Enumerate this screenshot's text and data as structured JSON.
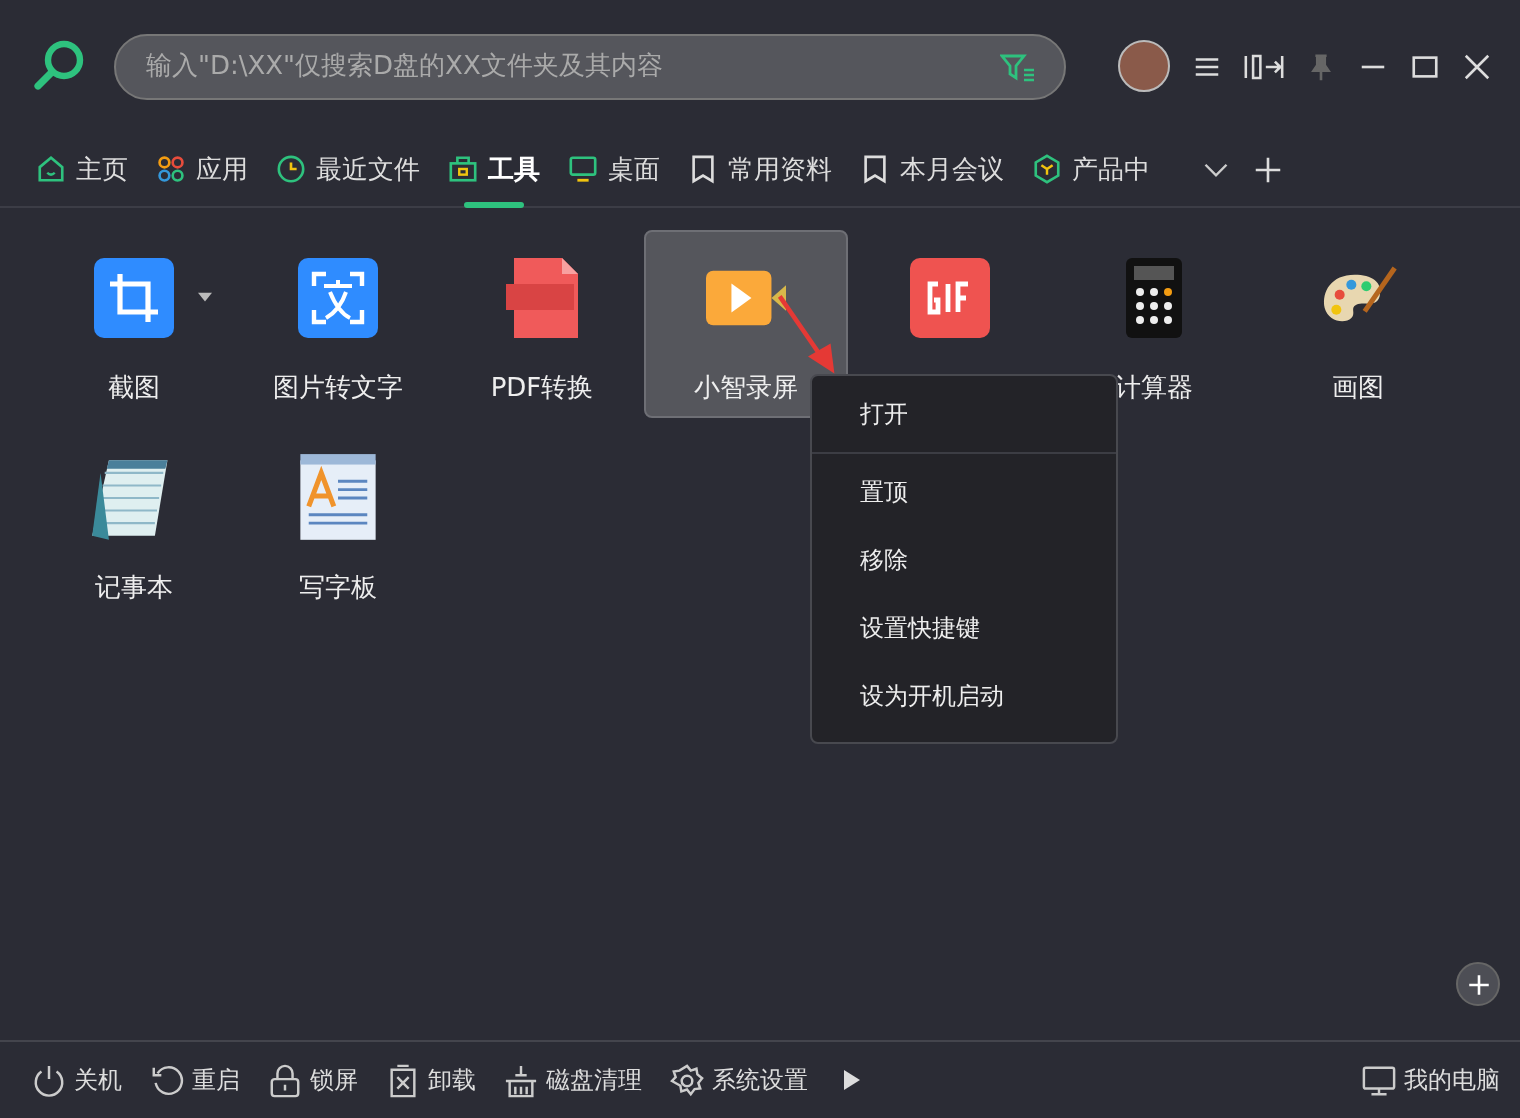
{
  "search": {
    "placeholder": "输入\"D:\\XX\"仅搜索D盘的XX文件夹及其内容"
  },
  "tabs": [
    {
      "label": "主页",
      "kind": "home",
      "selected": false
    },
    {
      "label": "应用",
      "kind": "apps",
      "selected": false
    },
    {
      "label": "最近文件",
      "kind": "clock",
      "selected": false
    },
    {
      "label": "工具",
      "kind": "toolbox",
      "selected": true
    },
    {
      "label": "桌面",
      "kind": "monitor",
      "selected": false
    },
    {
      "label": "常用资料",
      "kind": "bookmark",
      "selected": false
    },
    {
      "label": "本月会议",
      "kind": "bookmark",
      "selected": false
    },
    {
      "label": "产品中",
      "kind": "cube",
      "selected": false
    }
  ],
  "tools": [
    {
      "name": "截图",
      "kind": "crop",
      "selected": false,
      "dropdown": true
    },
    {
      "name": "图片转文字",
      "kind": "ocr",
      "selected": false,
      "dropdown": false
    },
    {
      "name": "PDF转换",
      "kind": "pdf",
      "selected": false,
      "dropdown": false
    },
    {
      "name": "小智录屏",
      "kind": "video",
      "selected": true,
      "dropdown": false
    },
    {
      "kind": "gif",
      "selected": false,
      "dropdown": false
    },
    {
      "name": "计算器",
      "kind": "calculator",
      "selected": false,
      "dropdown": false
    },
    {
      "name": "画图",
      "kind": "paint",
      "selected": false,
      "dropdown": false
    },
    {
      "name": "记事本",
      "kind": "notepad",
      "selected": false,
      "dropdown": false
    },
    {
      "name": "写字板",
      "kind": "wordpad",
      "selected": false,
      "dropdown": false
    }
  ],
  "context_menu": [
    {
      "label": "打开",
      "divider": true
    },
    {
      "label": "置顶",
      "divider": false
    },
    {
      "label": "移除",
      "divider": false
    },
    {
      "label": "设置快捷键",
      "divider": false
    },
    {
      "label": "设为开机启动",
      "divider": false
    }
  ],
  "footer": [
    {
      "label": "关机",
      "kind": "power"
    },
    {
      "label": "重启",
      "kind": "restart"
    },
    {
      "label": "锁屏",
      "kind": "lock"
    },
    {
      "label": "卸载",
      "kind": "uninstall"
    },
    {
      "label": "磁盘清理",
      "kind": "clean"
    },
    {
      "label": "系统设置",
      "kind": "settings"
    }
  ],
  "footer_right": {
    "label": "我的电脑"
  }
}
